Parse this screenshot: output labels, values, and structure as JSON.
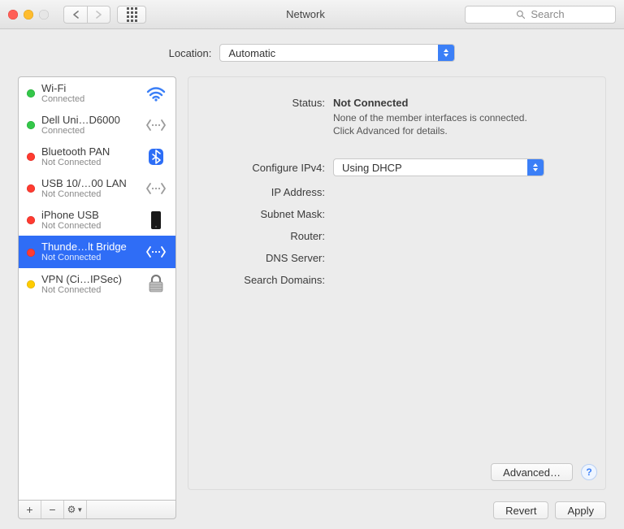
{
  "window": {
    "title": "Network"
  },
  "search": {
    "placeholder": "Search"
  },
  "location": {
    "label": "Location:",
    "value": "Automatic"
  },
  "sidebar": {
    "items": [
      {
        "name": "Wi-Fi",
        "status": "Connected",
        "dot": "green",
        "icon": "wifi-icon",
        "color": "#3b7ff7"
      },
      {
        "name": "Dell Uni…D6000",
        "status": "Connected",
        "dot": "green",
        "icon": "ethernet-icon",
        "color": "#9b9b9b"
      },
      {
        "name": "Bluetooth PAN",
        "status": "Not Connected",
        "dot": "red",
        "icon": "bluetooth-icon",
        "color": "#2d6ef6"
      },
      {
        "name": "USB 10/…00 LAN",
        "status": "Not Connected",
        "dot": "red",
        "icon": "ethernet-icon",
        "color": "#9b9b9b"
      },
      {
        "name": "iPhone USB",
        "status": "Not Connected",
        "dot": "red",
        "icon": "iphone-icon",
        "color": "#1a1a1a"
      },
      {
        "name": "Thunde…lt Bridge",
        "status": "Not Connected",
        "dot": "red",
        "icon": "ethernet-icon",
        "color": "#ffffff",
        "selected": true
      },
      {
        "name": "VPN (Ci…IPSec)",
        "status": "Not Connected",
        "dot": "yellow",
        "icon": "lock-icon",
        "color": "#7a7a7a"
      }
    ],
    "tools": {
      "add": "+",
      "remove": "−",
      "gear": "⚙︎"
    }
  },
  "detail": {
    "status_label": "Status:",
    "status_value": "Not Connected",
    "status_note_1": "None of the member interfaces is connected.",
    "status_note_2": "Click Advanced for details.",
    "ipv4_label": "Configure IPv4:",
    "ipv4_value": "Using DHCP",
    "ip_label": "IP Address:",
    "ip_value": "",
    "subnet_label": "Subnet Mask:",
    "subnet_value": "",
    "router_label": "Router:",
    "router_value": "",
    "dns_label": "DNS Server:",
    "dns_value": "",
    "domains_label": "Search Domains:",
    "domains_value": "",
    "advanced": "Advanced…",
    "help": "?"
  },
  "buttons": {
    "revert": "Revert",
    "apply": "Apply"
  }
}
